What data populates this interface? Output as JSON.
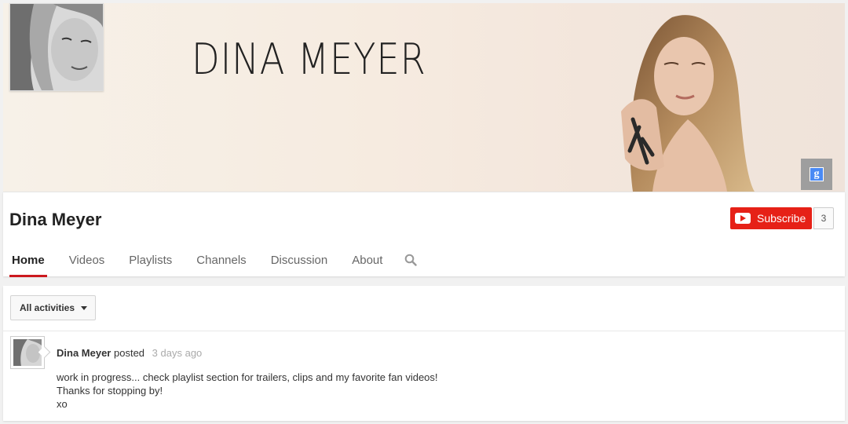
{
  "banner": {
    "title": "DINA MEYER"
  },
  "channel": {
    "name": "Dina Meyer",
    "subscribe_label": "Subscribe",
    "subscriber_count": "3"
  },
  "tabs": [
    {
      "label": "Home",
      "active": true
    },
    {
      "label": "Videos"
    },
    {
      "label": "Playlists"
    },
    {
      "label": "Channels"
    },
    {
      "label": "Discussion"
    },
    {
      "label": "About"
    }
  ],
  "icons": {
    "search": "search-icon",
    "google_plus": "google-plus-icon",
    "youtube": "youtube-icon"
  },
  "filter": {
    "label": "All activities"
  },
  "post": {
    "author": "Dina Meyer",
    "verb": "posted",
    "time": "3 days ago",
    "lines": [
      "work in progress... check playlist section for trailers, clips and my favorite fan videos!",
      "Thanks for stopping by!",
      "xo"
    ]
  },
  "colors": {
    "accent": "#e62117",
    "active_tab_underline": "#cc181e"
  }
}
